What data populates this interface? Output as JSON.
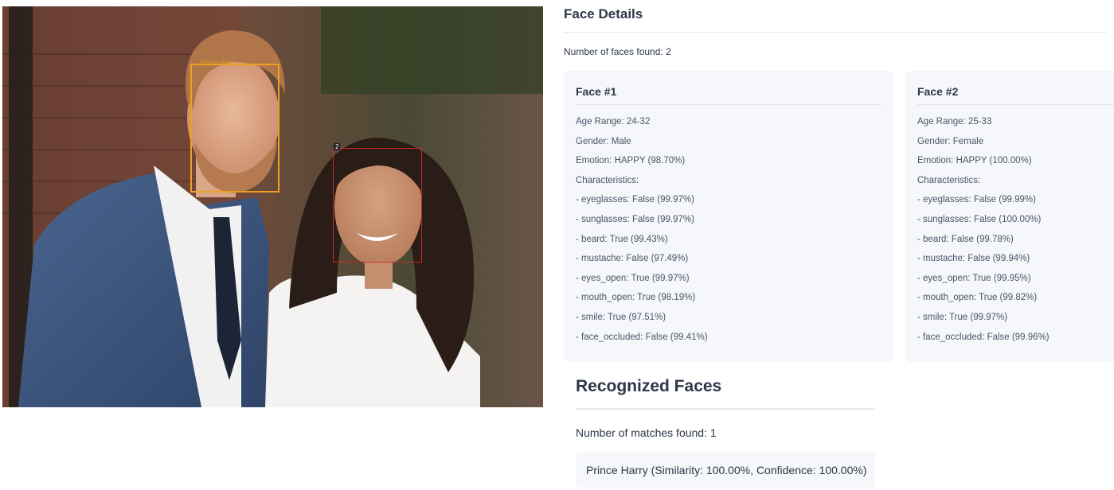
{
  "photo": {
    "faces": [
      {
        "tag": "Prince Harry",
        "color": "#f0a020"
      },
      {
        "tag": "2",
        "color": "#c62828"
      }
    ]
  },
  "details": {
    "title": "Face Details",
    "faces_found": "Number of faces found: 2",
    "faces": [
      {
        "title": "Face #1",
        "lines": [
          "Age Range: 24-32",
          "Gender: Male",
          "Emotion: HAPPY (98.70%)",
          "Characteristics:",
          "- eyeglasses: False (99.97%)",
          "- sunglasses: False (99.97%)",
          "- beard: True (99.43%)",
          "- mustache: False (97.49%)",
          "- eyes_open: True (99.97%)",
          "- mouth_open: True (98.19%)",
          "- smile: True (97.51%)",
          "- face_occluded: False (99.41%)"
        ]
      },
      {
        "title": "Face #2",
        "lines": [
          "Age Range: 25-33",
          "Gender: Female",
          "Emotion: HAPPY (100.00%)",
          "Characteristics:",
          "- eyeglasses: False (99.99%)",
          "- sunglasses: False (100.00%)",
          "- beard: False (99.78%)",
          "- mustache: False (99.94%)",
          "- eyes_open: True (99.95%)",
          "- mouth_open: True (99.82%)",
          "- smile: True (99.97%)",
          "- face_occluded: False (99.96%)"
        ]
      }
    ]
  },
  "recognized": {
    "title": "Recognized Faces",
    "matches_found": "Number of matches found: 1",
    "matches": [
      "Prince Harry (Similarity: 100.00%, Confidence: 100.00%)"
    ]
  }
}
